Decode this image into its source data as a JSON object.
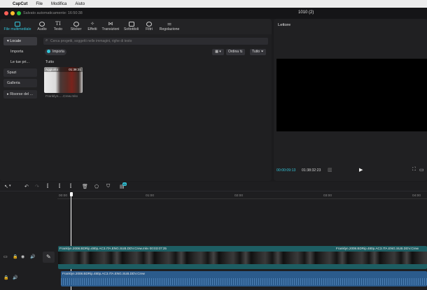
{
  "menubar": {
    "apple": "",
    "app": "CapCut",
    "file": "File",
    "edit": "Modifica",
    "help": "Aiuto"
  },
  "window": {
    "save_status": "Salvato automaticamente: 16:50:38",
    "project_title": "1010 (2)"
  },
  "toolbar": {
    "items": [
      {
        "label": "File multimediale",
        "icon": "media-icon"
      },
      {
        "label": "Audio",
        "icon": "audio-icon"
      },
      {
        "label": "Testo",
        "icon": "text-icon"
      },
      {
        "label": "Sticker",
        "icon": "sticker-icon"
      },
      {
        "label": "Effetti",
        "icon": "effects-icon"
      },
      {
        "label": "Transizioni",
        "icon": "transitions-icon"
      },
      {
        "label": "Sottotitoli",
        "icon": "subtitles-icon"
      },
      {
        "label": "Filtri",
        "icon": "filters-icon"
      },
      {
        "label": "Regolazione",
        "icon": "adjust-icon"
      }
    ]
  },
  "sidebar": {
    "items": [
      {
        "label": "▾ Locale"
      },
      {
        "label": "Importa"
      },
      {
        "label": "Le tue pri..."
      },
      {
        "label": "Spazi"
      },
      {
        "label": "Galleria"
      },
      {
        "label": "▸ Risorse del ..."
      }
    ]
  },
  "media": {
    "search_placeholder": "Cerca progetti, soggetti nelle immagini, righe di testo",
    "import_label": "Importa",
    "sort_label": "Ordina",
    "filter_label": "Tutto",
    "section_label": "Tutto",
    "clip": {
      "badge": "Aggiunto",
      "duration": "01:38:31",
      "filename": "Franklyn.....Crew.mkv"
    }
  },
  "player": {
    "title": "Lettore",
    "current_time": "00:00:09:13",
    "total_time": "01:38:32:23"
  },
  "timeline": {
    "ruler": [
      "00:00",
      "01:00",
      "02:00",
      "03:00",
      "04:00"
    ],
    "badge": "AI",
    "video_track_label": "Franklyn.2008.BDRip.480p.AC3.ITA.ENG.SUB.DDV.Crew.mkv  00:03:07:25",
    "video_track_label2": "Franklyn.2008.BDRip.480p.AC3.ITA.ENG.SUB.DDV.Crew",
    "audio_track_label": "Franklyn.2008.BDRip.480p.AC3.ITA.ENG.SUB.DDV.Crew"
  },
  "colors": {
    "accent": "#33c6da",
    "track_video": "#1d5e63",
    "track_audio": "#2b5b8c"
  }
}
